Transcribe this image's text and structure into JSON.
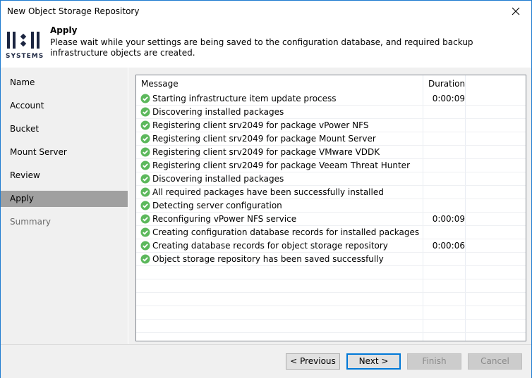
{
  "window": {
    "title": "New Object Storage Repository",
    "close_icon": "close-icon"
  },
  "header": {
    "logo_text": "SYSTEMS",
    "logo_mark": "11:11",
    "title": "Apply",
    "description": "Please wait while your settings are being saved to the configuration database, and required backup infrastructure objects are created."
  },
  "sidebar": {
    "items": [
      {
        "label": "Name",
        "state": "normal"
      },
      {
        "label": "Account",
        "state": "normal"
      },
      {
        "label": "Bucket",
        "state": "normal"
      },
      {
        "label": "Mount Server",
        "state": "normal"
      },
      {
        "label": "Review",
        "state": "normal"
      },
      {
        "label": "Apply",
        "state": "active"
      },
      {
        "label": "Summary",
        "state": "disabled"
      }
    ]
  },
  "table": {
    "columns": [
      "Message",
      "Duration"
    ],
    "status_icon": "success-check-icon",
    "status_color": "#5cb85c",
    "rows": [
      {
        "message": "Starting infrastructure item update process",
        "duration": "0:00:09"
      },
      {
        "message": "Discovering installed packages",
        "duration": ""
      },
      {
        "message": "Registering client srv2049 for package vPower NFS",
        "duration": ""
      },
      {
        "message": "Registering client srv2049 for package Mount Server",
        "duration": ""
      },
      {
        "message": "Registering client srv2049 for package VMware VDDK",
        "duration": ""
      },
      {
        "message": "Registering client srv2049 for package Veeam Threat Hunter",
        "duration": ""
      },
      {
        "message": "Discovering installed packages",
        "duration": ""
      },
      {
        "message": "All required packages have been successfully installed",
        "duration": ""
      },
      {
        "message": "Detecting server configuration",
        "duration": ""
      },
      {
        "message": "Reconfiguring vPower NFS service",
        "duration": "0:00:09"
      },
      {
        "message": "Creating configuration database records for installed packages",
        "duration": ""
      },
      {
        "message": "Creating database records for object storage repository",
        "duration": "0:00:06"
      },
      {
        "message": "Object storage repository has been saved successfully",
        "duration": ""
      }
    ]
  },
  "footer": {
    "previous_label": "< Previous",
    "next_label": "Next >",
    "finish_label": "Finish",
    "cancel_label": "Cancel"
  }
}
